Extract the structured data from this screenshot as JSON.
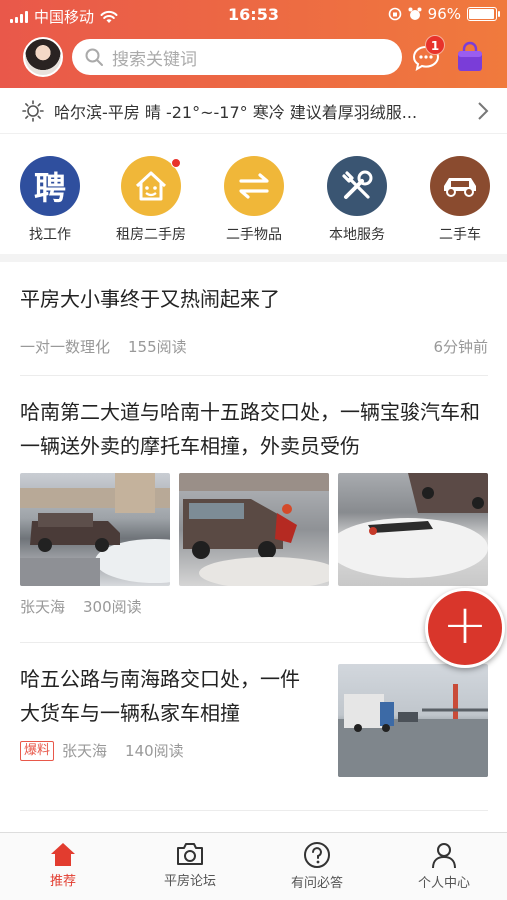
{
  "status": {
    "carrier": "中国移动",
    "time": "16:53",
    "battery": "96%",
    "battery_level": 0.96
  },
  "header": {
    "search_placeholder": "搜索关键词",
    "message_badge": "1"
  },
  "weather": {
    "text": "哈尔滨-平房 晴 -21°~-17° 寒冷 建议着厚羽绒服..."
  },
  "categories": [
    {
      "label": "找工作",
      "icon": "recruit-icon",
      "glyph": "聘",
      "color": "#2f4f9e"
    },
    {
      "label": "租房二手房",
      "icon": "house-icon",
      "color": "#f0b739"
    },
    {
      "label": "二手物品",
      "icon": "exchange-icon",
      "color": "#f0b739"
    },
    {
      "label": "本地服务",
      "icon": "tools-icon",
      "color": "#3a5572"
    },
    {
      "label": "二手车",
      "icon": "car-icon",
      "color": "#8a4b2f"
    }
  ],
  "articles": [
    {
      "title": "平房大小事终于又热闹起来了",
      "author": "一对一数理化",
      "reads": "155阅读",
      "time": "6分钟前"
    },
    {
      "title": "哈南第二大道与哈南十五路交口处，一辆宝骏汽车和一辆送外卖的摩托车相撞，外卖员受伤",
      "author": "张天海",
      "reads": "300阅读"
    },
    {
      "title": "哈五公路与南海路交口处，一件大货车与一辆私家车相撞",
      "tag": "爆料",
      "author": "张天海",
      "reads": "140阅读"
    }
  ],
  "nav": [
    {
      "label": "推荐",
      "icon": "home-icon",
      "active": true
    },
    {
      "label": "平房论坛",
      "icon": "camera-icon",
      "active": false
    },
    {
      "label": "有问必答",
      "icon": "question-icon",
      "active": false
    },
    {
      "label": "个人中心",
      "icon": "person-icon",
      "active": false
    }
  ],
  "colors": {
    "accent": "#e23c2f",
    "header_start": "#e9584a",
    "header_end": "#f07a3d"
  }
}
